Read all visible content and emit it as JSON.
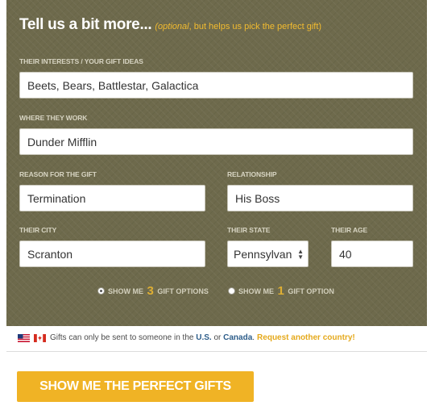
{
  "form": {
    "title": "Tell us a bit more...",
    "subtitle_optional": "(optional",
    "subtitle_rest": ", but helps us pick the perfect gift)",
    "interests": {
      "label": "THEIR INTERESTS / YOUR GIFT IDEAS",
      "value": "Beets, Bears, Battlestar, Galactica"
    },
    "work": {
      "label": "WHERE THEY WORK",
      "value": "Dunder Mifflin"
    },
    "reason": {
      "label": "REASON FOR THE GIFT",
      "value": "Termination"
    },
    "relationship": {
      "label": "RELATIONSHIP",
      "value": "His Boss"
    },
    "city": {
      "label": "THEIR CITY",
      "value": "Scranton"
    },
    "state": {
      "label": "THEIR STATE",
      "value": "Pennsylvan"
    },
    "age": {
      "label": "THEIR AGE",
      "value": "40"
    },
    "options": [
      {
        "prefix": "SHOW ME",
        "count": "3",
        "suffix": "GIFT OPTIONS",
        "selected": true
      },
      {
        "prefix": "SHOW ME",
        "count": "1",
        "suffix": "GIFT OPTION",
        "selected": false
      }
    ]
  },
  "shipping": {
    "text_before": "Gifts can only be sent to someone in the",
    "country_us": "U.S.",
    "text_or": "or",
    "country_ca": "Canada",
    "period": ".",
    "request_link": "Request another country!"
  },
  "cta": {
    "label": "SHOW ME THE PERFECT GIFTS"
  },
  "colors": {
    "panel": "#6e6a4c",
    "accent": "#f0b325",
    "link_blue": "#2d5d8a"
  }
}
